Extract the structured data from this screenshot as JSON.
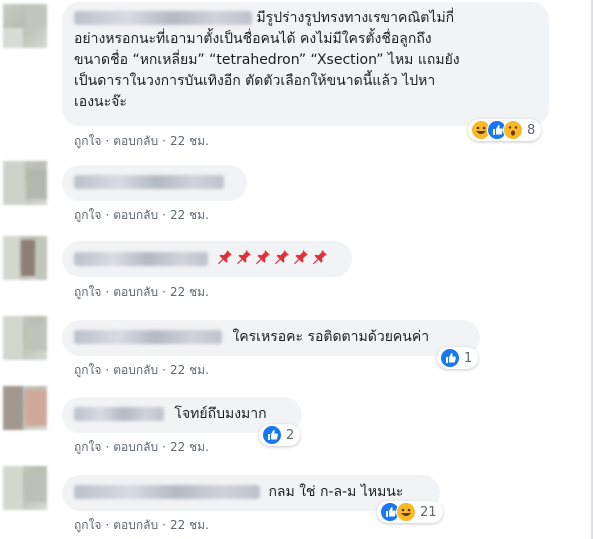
{
  "comments": [
    {
      "text": "มีรูปร่างรูปทรงทางเรขาคณิตไม่กี่\nอย่างหรอกนะที่เอามาตั้งเป็นชื่อคนได้ คงไม่มีใครตั้งชื่อลูกถึง\nขนาดชื่อ “หกเหลี่ยม” “tetrahedron” “Xsection” ไหม แถมยัง\nเป็นดาราในวงการบันเทิงอีก ตัดตัวเลือกให้ขนาดนี้แล้ว ไปหา\nเองนะจ๊ะ",
      "like": "ถูกใจ",
      "reply": "ตอบกลับ",
      "time": "22 ชม.",
      "reactions": [
        "haha",
        "like",
        "wow"
      ],
      "reaction_count": "8"
    },
    {
      "text": "",
      "like": "ถูกใจ",
      "reply": "ตอบกลับ",
      "time": "22 ชม."
    },
    {
      "text": "📌📌📌📌📌📌",
      "like": "ถูกใจ",
      "reply": "ตอบกลับ",
      "time": "22 ชม."
    },
    {
      "text": "ใครเหรอคะ รอติดตามด้วยคนค่า",
      "like": "ถูกใจ",
      "reply": "ตอบกลับ",
      "time": "22 ชม.",
      "reactions": [
        "like"
      ],
      "reaction_count": "1"
    },
    {
      "text": "โจทย์ถึบมงมาก",
      "like": "ถูกใจ",
      "reply": "ตอบกลับ",
      "time": "22 ชม.",
      "reactions": [
        "like"
      ],
      "reaction_count": "2"
    },
    {
      "text": "กลม ใช่ ก-ล-ม ไหมนะ",
      "like": "ถูกใจ",
      "reply": "ตอบกลับ",
      "time": "22 ชม.",
      "reactions": [
        "like",
        "haha"
      ],
      "reaction_count": "21"
    }
  ],
  "separator": "·",
  "colors": {
    "bubble": "#f2f3f5",
    "meta": "#606770",
    "like_blue": "#1877f2",
    "haha_yellow": "#f7b928"
  }
}
